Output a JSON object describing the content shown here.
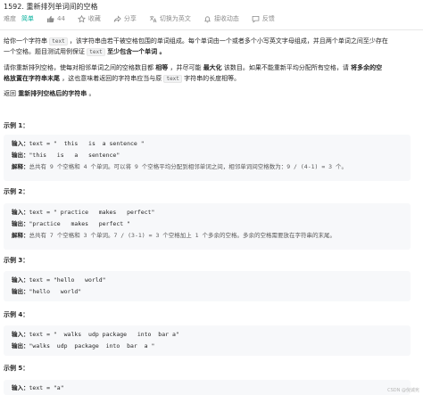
{
  "header": {
    "title": "1592. 重新排列单词间的空格",
    "difficulty_label": "难度",
    "difficulty": "简单",
    "likes": "44",
    "favorite": "收藏",
    "share": "分享",
    "switch_lang": "切换为英文",
    "notify": "接收动态",
    "feedback": "反馈"
  },
  "description": {
    "p1_a": "给你一个字符串 ",
    "p1_code": "text",
    "p1_b": " ，该字符串由若干被空格包围的单词组成。每个单词由一个或者多个小写英文字母组成，并且两个单词之间至少存在",
    "p1_c": "一个空格。题目测试用例保证 ",
    "p1_code2": "text",
    "p1_d": " 至少包含一个单词 。",
    "p2_a": "请你重新排列空格，使每对相邻单词之间的空格数目都 ",
    "p2_b": "相等",
    "p2_c": " ，并尽可能 ",
    "p2_d": "最大化",
    "p2_e": " 该数目。如果不能重新平均分配所有空格，请 ",
    "p2_f": "将多余的空",
    "p2_g": "格放置在字符串末尾",
    "p2_h": " ，这也意味着返回的字符串应当与原 ",
    "p2_code": "text",
    "p2_i": " 字符串的长度相等。",
    "p3_a": "返回 ",
    "p3_b": "重新排列空格后的字符串",
    "p3_c": " 。"
  },
  "examples": [
    {
      "heading": "示例 1：",
      "input_label": "输入：",
      "input": "text = \"  this   is  a sentence \"",
      "output_label": "输出：",
      "output": "\"this   is   a   sentence\"",
      "expl_label": "解释：",
      "expl": "总共有 9 个空格和 4 个单词。可以将 9 个空格平均分配到相邻单词之间，相邻单词间空格数为：9 / (4-1) = 3 个。"
    },
    {
      "heading": "示例 2：",
      "input_label": "输入：",
      "input": "text = \" practice   makes   perfect\"",
      "output_label": "输出：",
      "output": "\"practice   makes   perfect \"",
      "expl_label": "解释：",
      "expl": "总共有 7 个空格和 3 个单词。7 / (3-1) = 3 个空格加上 1 个多余的空格。多余的空格需要放在字符串的末尾。"
    },
    {
      "heading": "示例 3：",
      "input_label": "输入：",
      "input": "text = \"hello   world\"",
      "output_label": "输出：",
      "output": "\"hello   world\""
    },
    {
      "heading": "示例 4：",
      "input_label": "输入：",
      "input": "text = \"  walks  udp package   into  bar a\"",
      "output_label": "输出：",
      "output": "\"walks  udp  package  into  bar  a \""
    },
    {
      "heading": "示例 5：",
      "input_label": "输入：",
      "input": "text = \"a\""
    }
  ],
  "watermark": "CSDN @倪诚宪",
  "colors": {
    "accent": "#00af9b",
    "text": "#262626",
    "muted": "#8c8c8c",
    "code_bg": "#f7f8fa"
  }
}
